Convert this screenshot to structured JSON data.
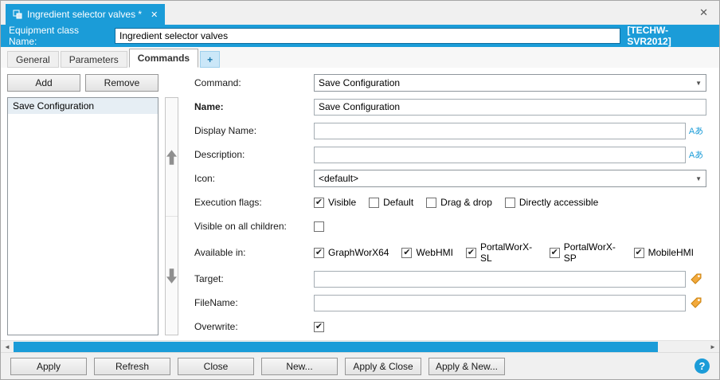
{
  "window": {
    "tab_title": "Ingredient selector valves *",
    "server_badge": "[TECHW-SVR2012]"
  },
  "icons": {
    "close": "✕",
    "dropdown": "▼",
    "localize": "Aあ",
    "scroll_left": "◄",
    "scroll_right": "►"
  },
  "header": {
    "label": "Equipment class Name:",
    "value": "Ingredient selector valves"
  },
  "tabs": [
    {
      "label": "General"
    },
    {
      "label": "Parameters"
    },
    {
      "label": "Commands"
    },
    {
      "label": "+"
    }
  ],
  "left_panel": {
    "add_label": "Add",
    "remove_label": "Remove",
    "items": [
      "Save Configuration"
    ]
  },
  "form": {
    "command": {
      "label": "Command:",
      "value": "Save Configuration"
    },
    "name": {
      "label": "Name:",
      "value": "Save Configuration"
    },
    "display_name": {
      "label": "Display Name:",
      "value": ""
    },
    "description": {
      "label": "Description:",
      "value": ""
    },
    "icon_field": {
      "label": "Icon:",
      "value": "<default>"
    },
    "execution_flags": {
      "label": "Execution flags:",
      "options": [
        {
          "label": "Visible",
          "checked": true
        },
        {
          "label": "Default",
          "checked": false
        },
        {
          "label": "Drag & drop",
          "checked": false
        },
        {
          "label": "Directly accessible",
          "checked": false
        }
      ]
    },
    "visible_on_all_children": {
      "label": "Visible on all children:",
      "checked": false
    },
    "available_in": {
      "label": "Available in:",
      "options": [
        {
          "label": "GraphWorX64",
          "checked": true
        },
        {
          "label": "WebHMI",
          "checked": true
        },
        {
          "label": "PortalWorX-SL",
          "checked": true
        },
        {
          "label": "PortalWorX-SP",
          "checked": true
        },
        {
          "label": "MobileHMI",
          "checked": true
        }
      ]
    },
    "target": {
      "label": "Target:",
      "value": ""
    },
    "filename": {
      "label": "FileName:",
      "value": ""
    },
    "overwrite": {
      "label": "Overwrite:",
      "checked": true
    }
  },
  "footer": {
    "buttons": [
      "Apply",
      "Refresh",
      "Close",
      "New...",
      "Apply & Close",
      "Apply & New..."
    ],
    "help_label": "?"
  }
}
